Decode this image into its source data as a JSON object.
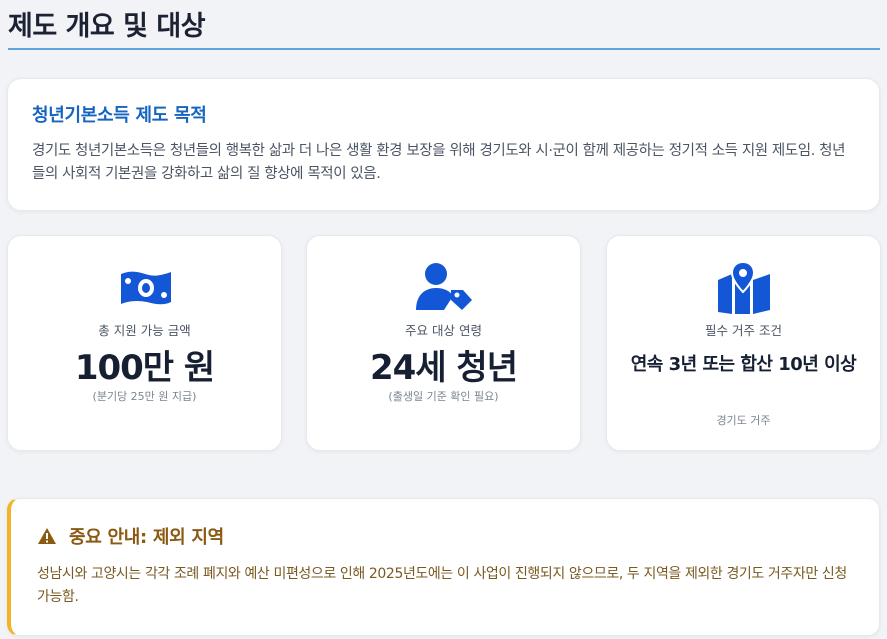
{
  "page": {
    "title": "제도 개요 및 대상"
  },
  "purpose": {
    "title": "청년기본소득 제도 목적",
    "body": "경기도 청년기본소득은 청년들의 행복한 삶과 더 나은 생활 환경 보장을 위해 경기도와 시·군이 함께 제공하는 정기적 소득 지원 제도임. 청년들의 사회적 기본권을 강화하고 삶의 질 향상에 목적이 있음."
  },
  "stats": [
    {
      "icon": "money-bill-icon",
      "label": "총 지원 가능 금액",
      "value": "100만 원",
      "note": "(분기당 25만 원 지급)"
    },
    {
      "icon": "user-tag-icon",
      "label": "주요 대상 연령",
      "value": "24세 청년",
      "note": "(출생일 기준 확인 필요)"
    },
    {
      "icon": "map-marker-icon",
      "label": "필수 거주 조건",
      "value": "연속 3년 또는 합산 10년 이상",
      "note": "경기도 거주"
    }
  ],
  "notice": {
    "icon": "warning-triangle-icon",
    "title": "중요 안내: 제외 지역",
    "body": "성남시와 고양시는 각각 조례 폐지와 예산 미편성으로 인해 2025년도에는 이 사업이 진행되지 않으므로, 두 지역을 제외한 경기도 거주자만 신청 가능함."
  },
  "colors": {
    "accent": "#1565c0",
    "icon_blue": "#1457d6",
    "title_rule": "#5ba4dc",
    "warning_border": "#f0b429",
    "warning_text": "#8a5a12"
  }
}
